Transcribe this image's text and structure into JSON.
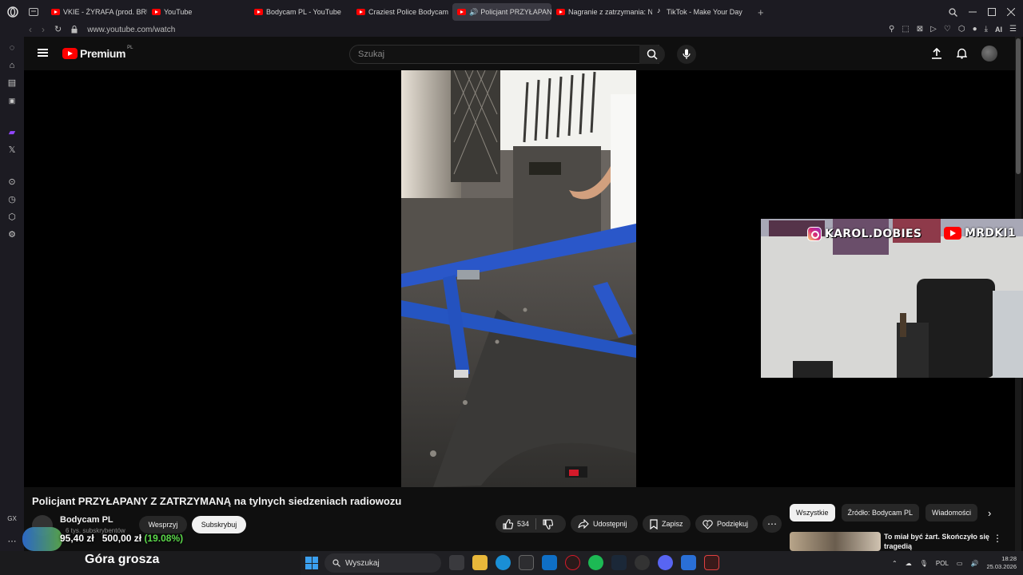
{
  "browser": {
    "tabs": [
      {
        "label": "VKIE - ŻYRAFA (prod. BRU",
        "icon": "youtube-icon"
      },
      {
        "label": "YouTube",
        "icon": "youtube-icon"
      },
      {
        "label": "Bodycam PL - YouTube",
        "icon": "youtube-icon"
      },
      {
        "label": "Craziest Police Bodycam",
        "icon": "youtube-icon"
      },
      {
        "label": "Policjant PRZYŁAPAN",
        "icon": "youtube-icon",
        "active": true
      },
      {
        "label": "Nagranie z zatrzymania: N",
        "icon": "youtube-icon"
      },
      {
        "label": "TikTok - Make Your Day",
        "icon": "tiktok-icon"
      }
    ],
    "url": "www.youtube.com/watch",
    "ext_label_ai": "AI",
    "sidebar_label_gx": "GX",
    "new_tab": "+"
  },
  "youtube": {
    "logo_word": "Premium",
    "logo_region": "PL",
    "search_placeholder": "Szukaj",
    "video_title": "Policjant PRZYŁAPANY Z ZATRZYMANĄ na tylnych siedzeniach radiowozu",
    "channel_name": "Bodycam PL",
    "subscribers": "6 tys. subskrybentów",
    "support_label": "Wesprzyj",
    "subscribe_label": "Subskrybuj",
    "likes": "534",
    "share_label": "Udostępnij",
    "save_label": "Zapisz",
    "thanks_label": "Podziękuj",
    "more_label": "⋯",
    "chips": [
      "Wszystkie",
      "Źródło: Bodycam PL",
      "Wiadomości"
    ],
    "rec_title": "To miał być żart. Skończyło się tragedią"
  },
  "overlay": {
    "instagram": "KAROL.DOBIES",
    "youtube_handle": "MRDKI1",
    "goal_current": "95,40 zł",
    "goal_target": "500,00 zł",
    "goal_pct": "(19.08%)",
    "goal_fraction": 0.1908,
    "gora_grosza": "Góra grosza"
  },
  "taskbar": {
    "search": "Wyszukaj",
    "lang": "POL",
    "time": "18:28",
    "date": "25.03.2026"
  }
}
